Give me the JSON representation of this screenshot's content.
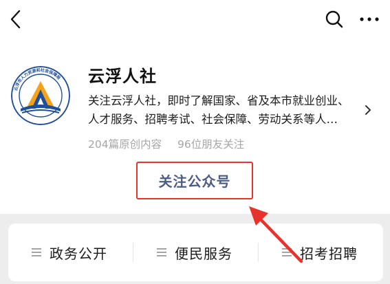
{
  "header": {
    "back_icon": "chevron-left-icon",
    "search_icon": "search-icon",
    "more_icon": "more-horizontal-icon"
  },
  "profile": {
    "name": "云浮人社",
    "description_line1": "关注云浮人社，即时了解国家、省及本市就业创业、",
    "description_line2": "人才服务、招聘考试、社会保障、劳动关系等人…",
    "original_count": "204篇原创内容",
    "friends_following": "96位朋友关注",
    "avatar_text": "云浮市人力资源和社会保障局"
  },
  "follow": {
    "label": "关注公众号"
  },
  "menu": {
    "items": [
      {
        "label": "政务公开"
      },
      {
        "label": "便民服务"
      },
      {
        "label": "招考招聘"
      }
    ]
  },
  "colors": {
    "highlight": "#e8322c",
    "follow_text": "#4b5d85",
    "muted": "#a6a6a6",
    "menu_bg": "#ededed"
  }
}
